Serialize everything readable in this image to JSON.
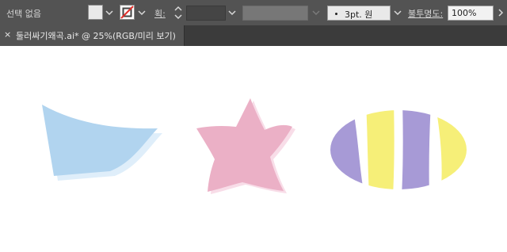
{
  "toolbar": {
    "selection_label": "선택 없음",
    "stroke_label": "획:",
    "brush_value": "3pt. 원",
    "opacity_label": "불투명도:",
    "opacity_value": "100%"
  },
  "tab": {
    "close": "×",
    "title": "둘러싸기왜곡.ai* @ 25%(RGB/미리 보기)"
  },
  "colors": {
    "blue_shape": "#b1d4ef",
    "pink_star": "#ebb0c6",
    "purple": "#a79ad6",
    "yellow": "#f6ef78"
  },
  "icons": {
    "fill": "fill-swatch-icon",
    "stroke": "stroke-none-swatch-icon",
    "stepper": "stepper-icon",
    "brush_dot": "brush-dot-icon"
  }
}
